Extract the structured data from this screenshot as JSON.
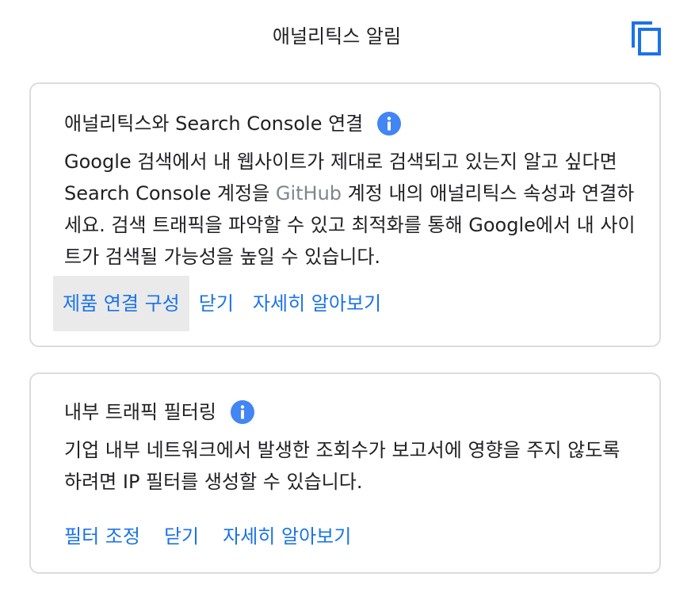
{
  "header": {
    "title": "애널리틱스 알림",
    "copy_icon": "copy-icon"
  },
  "colors": {
    "accent": "#1a73e8",
    "info_icon": "#4285f4",
    "card_border": "#dadce0",
    "muted_text": "#80868b",
    "hover_bg": "#eaeaea"
  },
  "cards": [
    {
      "title": "애널리틱스와 Search Console 연결",
      "info_icon": "info-icon",
      "body_before": "Google 검색에서 내 웹사이트가 제대로 검색되고 있는지 알고 싶다면 Search Console 계정을 ",
      "body_muted": "GitHub",
      "body_after": " 계정 내의 애널리틱스 속성과 연결하세요. 검색 트래픽을 파악할 수 있고 최적화를 통해 Google에서 내 사이트가 검색될 가능성을 높일 수 있습니다.",
      "actions": {
        "primary": "제품 연결 구성",
        "dismiss": "닫기",
        "learn_more": "자세히 알아보기"
      }
    },
    {
      "title": "내부 트래픽 필터링",
      "info_icon": "info-icon",
      "body": "기업 내부 네트워크에서 발생한 조회수가 보고서에 영향을 주지 않도록 하려면 IP 필터를 생성할 수 있습니다.",
      "actions": {
        "primary": "필터 조정",
        "dismiss": "닫기",
        "learn_more": "자세히 알아보기"
      }
    }
  ]
}
